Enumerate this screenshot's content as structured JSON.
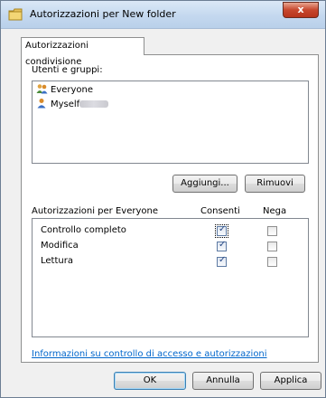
{
  "window": {
    "title": "Autorizzazioni per New folder",
    "close_label": "x"
  },
  "tab": {
    "label": "Autorizzazioni condivisione"
  },
  "groups": {
    "label": "Utenti e gruppi:",
    "items": [
      {
        "name": "Everyone",
        "icon": "users-group-icon"
      },
      {
        "name": "Myself",
        "icon": "user-icon",
        "redacted_suffix": true
      }
    ]
  },
  "buttons": {
    "add": "Aggiungi...",
    "remove": "Rimuovi"
  },
  "permissions": {
    "header": "Autorizzazioni per Everyone",
    "allow_header": "Consenti",
    "deny_header": "Nega",
    "rows": [
      {
        "name": "Controllo completo",
        "allow": true,
        "deny": false
      },
      {
        "name": "Modifica",
        "allow": true,
        "deny": false
      },
      {
        "name": "Lettura",
        "allow": true,
        "deny": false
      }
    ]
  },
  "link": "Informazioni su controllo di accesso e autorizzazioni",
  "footer": {
    "ok": "OK",
    "cancel": "Annulla",
    "apply": "Applica"
  }
}
